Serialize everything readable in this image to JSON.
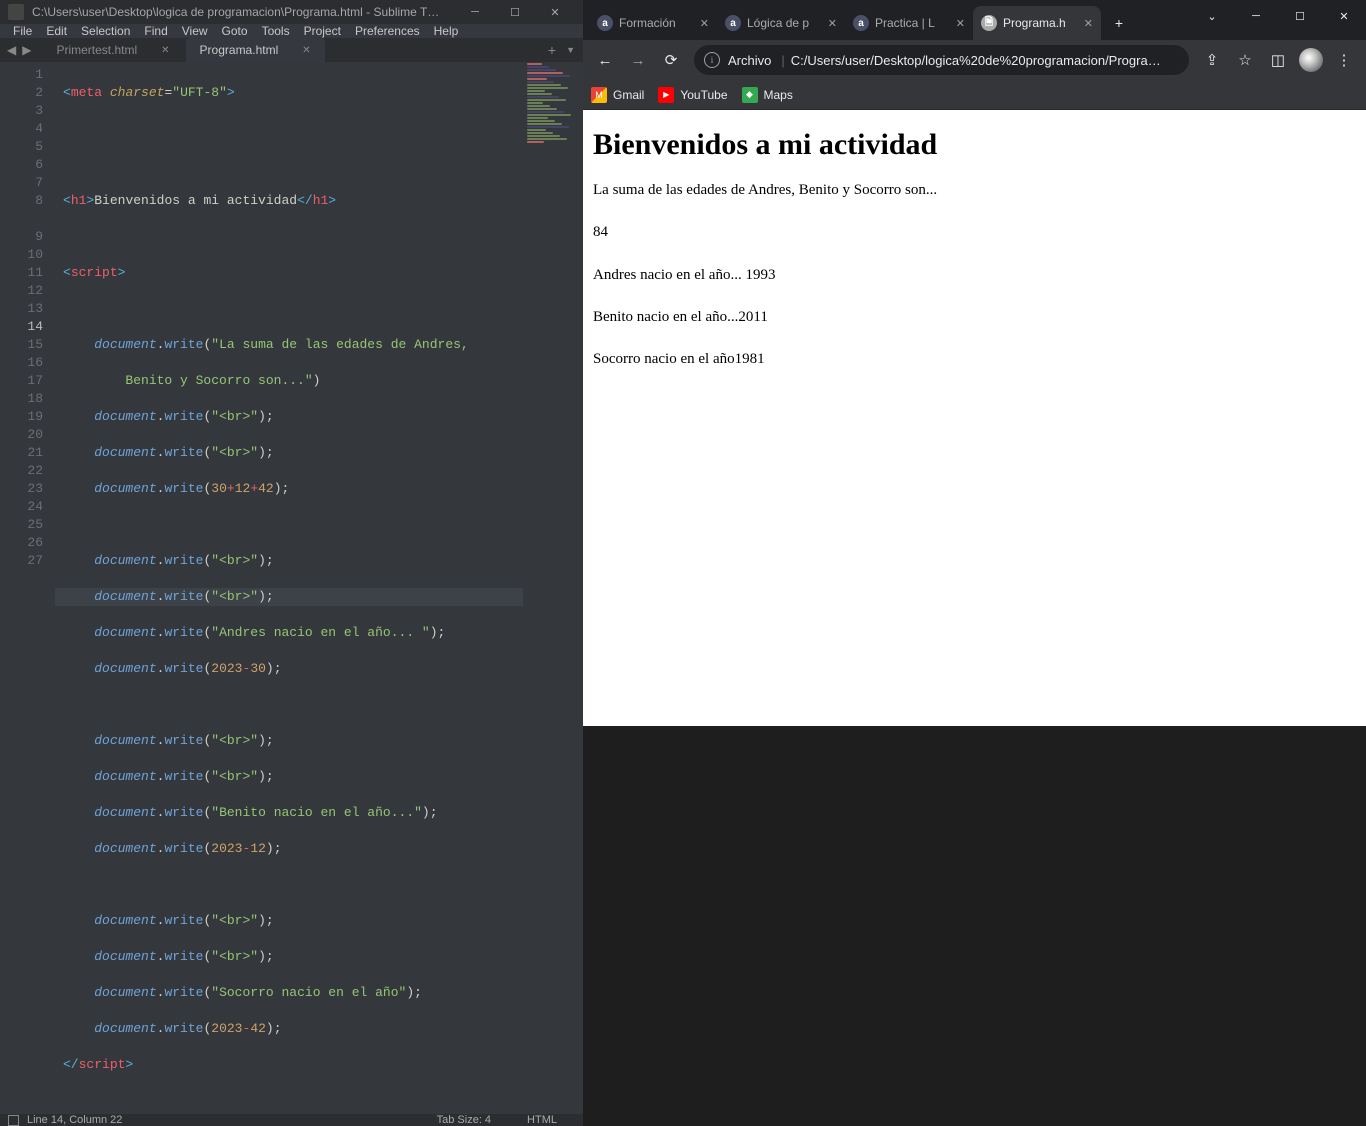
{
  "sublime": {
    "title": "C:\\Users\\user\\Desktop\\logica de programacion\\Programa.html - Sublime T…",
    "menu": [
      "File",
      "Edit",
      "Selection",
      "Find",
      "View",
      "Goto",
      "Tools",
      "Project",
      "Preferences",
      "Help"
    ],
    "tabs": [
      {
        "label": "Primertest.html",
        "active": false
      },
      {
        "label": "Programa.html",
        "active": true
      }
    ],
    "active_line": 14,
    "status_left": "Line 14, Column 22",
    "status_tabsize": "Tab Size: 4",
    "status_lang": "HTML",
    "code_lines": 27
  },
  "chrome": {
    "tabs": [
      {
        "label": "Formación",
        "active": false,
        "fav": "a"
      },
      {
        "label": "Lógica de p",
        "active": false,
        "fav": "a"
      },
      {
        "label": "Practica | L",
        "active": false,
        "fav": "a"
      },
      {
        "label": "Programa.h",
        "active": true,
        "fav": "doc"
      }
    ],
    "url_proto": "Archivo",
    "url_path": "C:/Users/user/Desktop/logica%20de%20programacion/Progra…",
    "bookmarks": [
      {
        "label": "Gmail",
        "cls": "bm-gmail"
      },
      {
        "label": "YouTube",
        "cls": "bm-yt"
      },
      {
        "label": "Maps",
        "cls": "bm-maps"
      }
    ],
    "page": {
      "h1": "Bienvenidos a mi actividad",
      "l1": "La suma de las edades de Andres, Benito y Socorro son...",
      "l2": "84",
      "l3": "Andres nacio en el año... 1993",
      "l4": "Benito nacio en el año...2011",
      "l5": "Socorro nacio en el año1981"
    }
  }
}
